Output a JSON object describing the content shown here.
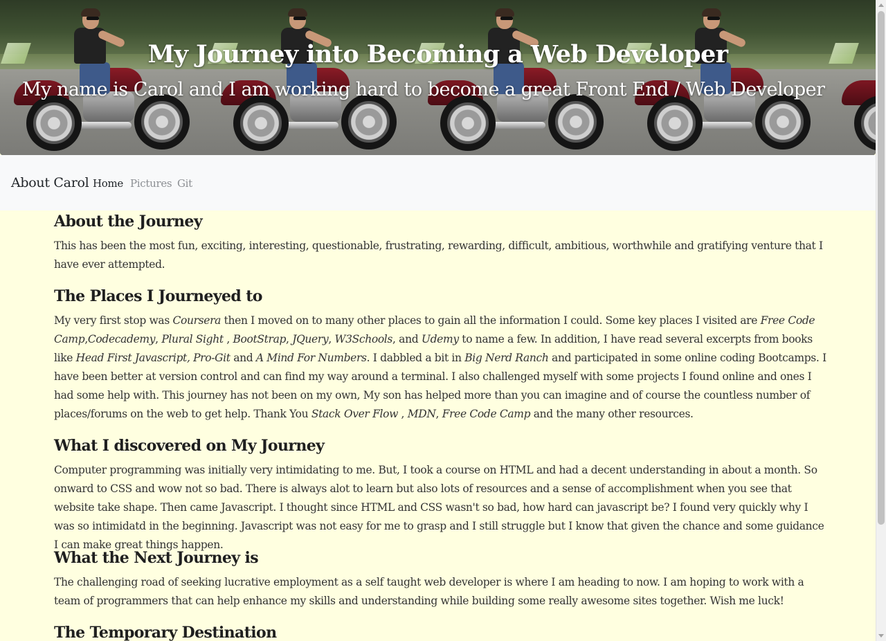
{
  "hero": {
    "title": "My Journey into Becoming a Web Developer",
    "subtitle": "My name is Carol and I am working hard to become a great Front End / Web Developer"
  },
  "navbar": {
    "brand": "About Carol",
    "links": [
      "Home",
      "Pictures",
      "Git"
    ]
  },
  "sections": [
    {
      "heading": "About the Journey",
      "body": "This has been the most fun, exciting, interesting, questionable, frustrating, rewarding, difficult, ambitious, worthwhile and gratifying venture that I have ever attempted."
    },
    {
      "heading": "The Places I Journeyed to",
      "parts": [
        "My very first stop was ",
        "Coursera",
        " then I moved on to many other places to gain all the information I could. Some key places I visited are ",
        "Free Code Camp",
        ",",
        "Codecademy",
        ", ",
        "Plural Sight",
        " , ",
        "BootStrap",
        ", ",
        "JQuery",
        ", ",
        "W3Schools",
        ", and ",
        "Udemy",
        " to name a few. In addition, I have read several excerpts from books like ",
        "Head First Javascript, Pro-Git",
        " and ",
        "A Mind For Numbers",
        ". I dabbled a bit in ",
        "Big Nerd Ranch",
        " and participated in some online coding Bootcamps. I have been better at version control and can find my way around a terminal. I also challenged myself with some projects I found online and ones I had some help with. This journey has not been on my own, My son has helped more than you can imagine and of course the countless number of places/forums on the web to get help. Thank You ",
        "Stack Over Flow",
        " , ",
        "MDN",
        ", ",
        "Free Code Camp",
        " and the many other resources."
      ]
    },
    {
      "heading": "What I discovered on My Journey",
      "body": "Computer programming was initially very intimidating to me. But, I took a course on HTML and had a decent understanding in about a month. So onward to CSS and wow not so bad. There is always alot to learn but also lots of resources and a sense of accomplishment when you see that website take shape. Then came Javascript. I thought since HTML and CSS wasn't so bad, how hard can javascript be? I found very quickly why I was so intimidatd in the beginning. Javascript was not easy for me to grasp and I still struggle but I know that given the chance and some guidance I can make great things happen."
    },
    {
      "heading": "What the Next Journey is",
      "body": "The challenging road of seeking lucrative employment as a self taught web developer is where I am heading to now. I am hoping to work with a team of programmers that can help enhance my skills and understanding while building some really awesome sites together. Wish me luck!"
    },
    {
      "heading": "The Temporary Destination"
    }
  ],
  "colors": {
    "page_background": "#ffffe0",
    "navbar_background": "#f8f9fa",
    "nav_active": "#212529",
    "nav_inactive": "#8c8f93"
  }
}
